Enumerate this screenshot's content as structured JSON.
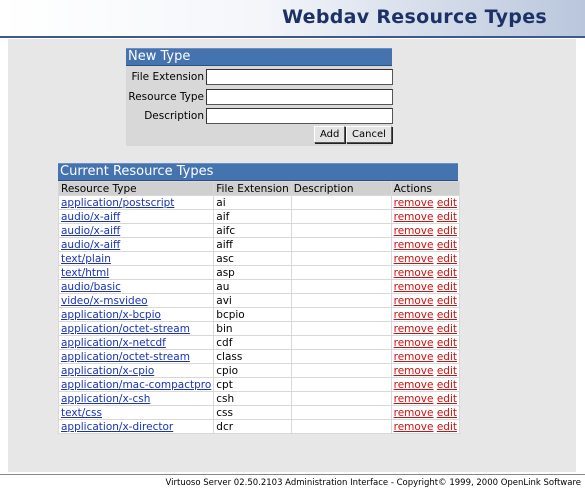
{
  "header": {
    "title": "Webdav Resource Types"
  },
  "new_type": {
    "heading": "New Type",
    "fields": [
      {
        "label": "File Extension",
        "value": ""
      },
      {
        "label": "Resource Type",
        "value": ""
      },
      {
        "label": "Description",
        "value": ""
      }
    ],
    "add_label": "Add",
    "cancel_label": "Cancel"
  },
  "current": {
    "heading": "Current Resource Types",
    "columns": [
      "Resource Type",
      "File Extension",
      "Description",
      "Actions"
    ],
    "remove_label": "remove",
    "edit_label": "edit",
    "rows": [
      {
        "type": "application/postscript",
        "ext": "ai",
        "desc": ""
      },
      {
        "type": "audio/x-aiff",
        "ext": "aif",
        "desc": ""
      },
      {
        "type": "audio/x-aiff",
        "ext": "aifc",
        "desc": ""
      },
      {
        "type": "audio/x-aiff",
        "ext": "aiff",
        "desc": ""
      },
      {
        "type": "text/plain",
        "ext": "asc",
        "desc": ""
      },
      {
        "type": "text/html",
        "ext": "asp",
        "desc": ""
      },
      {
        "type": "audio/basic",
        "ext": "au",
        "desc": ""
      },
      {
        "type": "video/x-msvideo",
        "ext": "avi",
        "desc": ""
      },
      {
        "type": "application/x-bcpio",
        "ext": "bcpio",
        "desc": ""
      },
      {
        "type": "application/octet-stream",
        "ext": "bin",
        "desc": ""
      },
      {
        "type": "application/x-netcdf",
        "ext": "cdf",
        "desc": ""
      },
      {
        "type": "application/octet-stream",
        "ext": "class",
        "desc": ""
      },
      {
        "type": "application/x-cpio",
        "ext": "cpio",
        "desc": ""
      },
      {
        "type": "application/mac-compactpro",
        "ext": "cpt",
        "desc": ""
      },
      {
        "type": "application/x-csh",
        "ext": "csh",
        "desc": ""
      },
      {
        "type": "text/css",
        "ext": "css",
        "desc": ""
      },
      {
        "type": "application/x-director",
        "ext": "dcr",
        "desc": ""
      }
    ]
  },
  "footer": {
    "text": "Virtuoso Server 02.50.2103 Administration Interface - Copyright© 1999, 2000 OpenLink Software"
  },
  "colors": {
    "accent": "#4573b0",
    "title": "#1c3266",
    "link": "#1a33b3",
    "action_link": "#cc1111"
  }
}
